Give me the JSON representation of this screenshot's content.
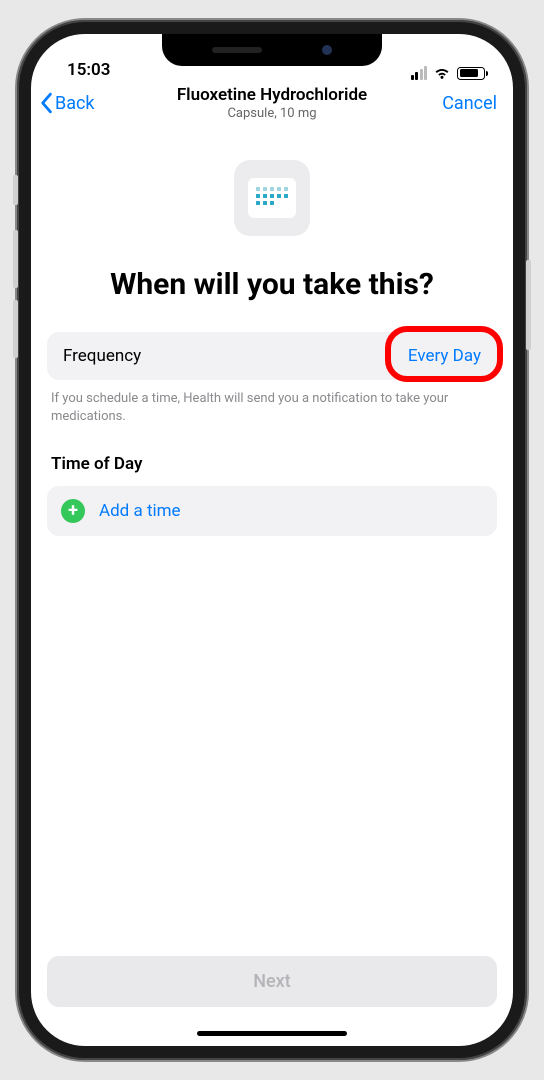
{
  "status": {
    "time": "15:03"
  },
  "nav": {
    "back": "Back",
    "title": "Fluoxetine Hydrochloride",
    "subtitle": "Capsule, 10 mg",
    "cancel": "Cancel"
  },
  "headline": "When will you take this?",
  "frequency": {
    "label": "Frequency",
    "value": "Every Day",
    "help": "If you schedule a time, Health will send you a notification to take your medications."
  },
  "time_section": {
    "title": "Time of Day",
    "add": "Add a time"
  },
  "footer": {
    "next": "Next"
  }
}
